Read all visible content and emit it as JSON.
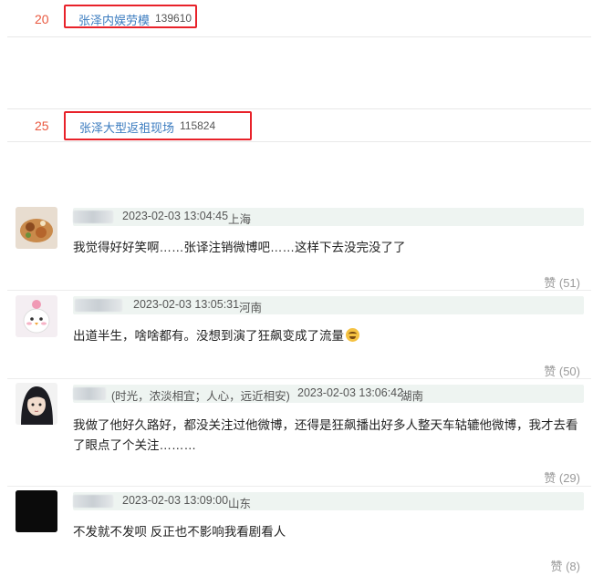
{
  "hot_list": [
    {
      "rank": "20",
      "title": "张泽内娱劳模",
      "count": "139610"
    },
    {
      "rank": "25",
      "title": "张泽大型返祖现场",
      "count": "115824"
    }
  ],
  "comments": [
    {
      "time": "2023-02-03 13:04:45",
      "location": "上海",
      "text": "我觉得好好笑啊……张译注销微博吧……这样下去没完没了了",
      "like": "赞 (51)"
    },
    {
      "time": "2023-02-03 13:05:31",
      "location": "河南",
      "text": "出道半生，啥啥都有。没想到演了狂飙变成了流量",
      "like": "赞 (50)"
    },
    {
      "motto": "(时光，浓淡相宜；人心，远近相安)",
      "time": "2023-02-03 13:06:42",
      "location": "湖南",
      "text": "我做了他好久路好，都没关注过他微博，还得是狂飙播出好多人整天车轱辘他微博，我才去看了眼点了个关注………",
      "like": "赞 (29)"
    },
    {
      "time": "2023-02-03 13:09:00",
      "location": "山东",
      "text": "不发就不发呗 反正也不影响我看剧看人",
      "like": "赞 (8)"
    }
  ]
}
